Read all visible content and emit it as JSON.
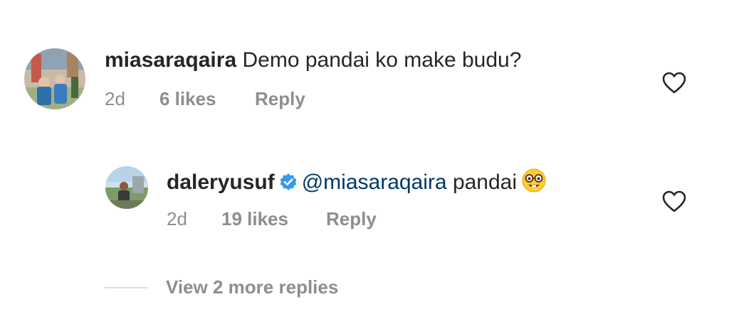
{
  "comments": [
    {
      "username": "miasaraqaira",
      "text": "Demo pandai ko make budu?",
      "time": "2d",
      "likes": "6 likes",
      "reply": "Reply",
      "like_icon": "heart-outline-icon"
    }
  ],
  "reply": {
    "username": "daleryusuf",
    "verified_icon": "verified-badge-icon",
    "mention": "@miasaraqaira",
    "text": "pandai",
    "emoji": "nerd-face-emoji",
    "time": "2d",
    "likes": "19 likes",
    "reply": "Reply",
    "like_icon": "heart-outline-icon"
  },
  "view_more": "View 2 more replies",
  "colors": {
    "text": "#262626",
    "secondary": "#8e8e8e",
    "mention": "#00376b",
    "verified": "#3897f0"
  }
}
